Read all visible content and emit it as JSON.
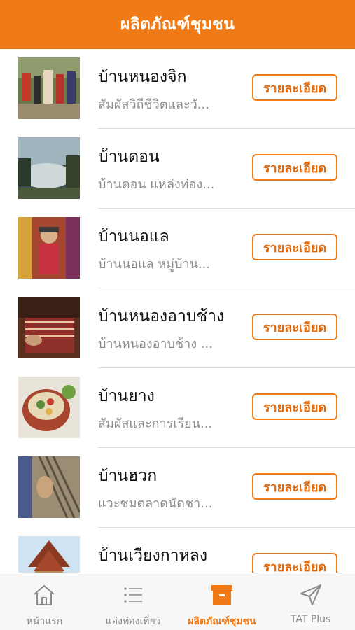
{
  "header": {
    "title": "ผลิตภัณฑ์ชุมชน"
  },
  "list": {
    "detail_label": "รายละเอียด",
    "items": [
      {
        "title": "บ้านหนองจิก",
        "desc": "สัมผัสวิถีชีวิตและวั..."
      },
      {
        "title": "บ้านดอน",
        "desc": "บ้านดอน แหล่งท่อง..."
      },
      {
        "title": "บ้านนอแล",
        "desc": "บ้านนอแล หมู่บ้าน..."
      },
      {
        "title": "บ้านหนองอาบช้าง",
        "desc": "บ้านหนองอาบช้าง ..."
      },
      {
        "title": "บ้านยาง",
        "desc": "สัมผัสและการเรียน..."
      },
      {
        "title": "บ้านฮวก",
        "desc": "แวะชมตลาดนัดชา..."
      },
      {
        "title": "บ้านเวียงกาหลง",
        "desc": ""
      }
    ]
  },
  "tabbar": {
    "tabs": [
      {
        "label": "หน้าแรก",
        "icon": "home-icon",
        "active": false
      },
      {
        "label": "แอ่งท่องเที่ยว",
        "icon": "list-icon",
        "active": false
      },
      {
        "label": "ผลิตภัณฑ์ชุมชน",
        "icon": "archive-box-icon",
        "active": true
      },
      {
        "label": "TAT Plus",
        "icon": "paper-plane-icon",
        "active": false
      }
    ]
  },
  "colors": {
    "accent": "#f07a16",
    "text": "#111111",
    "muted": "#8a8a8a"
  }
}
